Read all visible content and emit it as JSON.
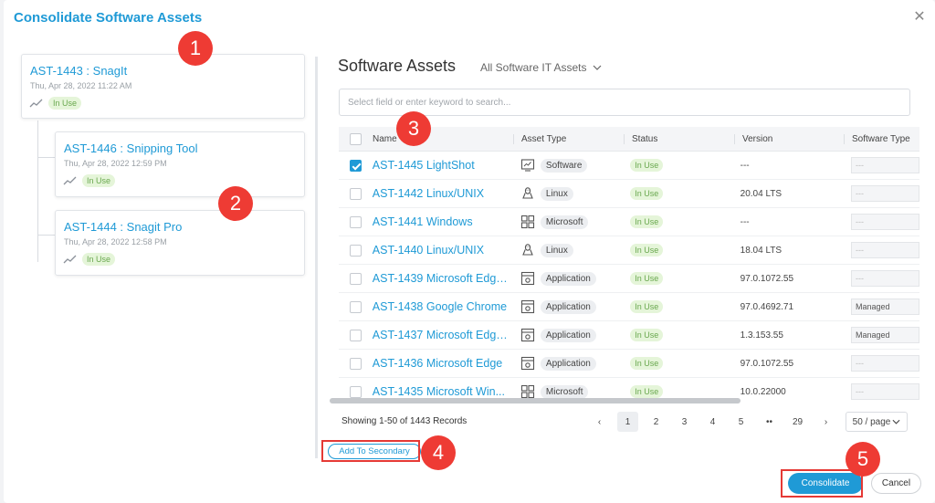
{
  "dialog": {
    "title": "Consolidate Software Assets"
  },
  "cards": [
    {
      "title": "AST-1443 : SnagIt",
      "date": "Thu, Apr 28, 2022 11:22 AM",
      "status": "In Use"
    },
    {
      "title": "AST-1446 : Snipping Tool",
      "date": "Thu, Apr 28, 2022 12:59 PM",
      "status": "In Use"
    },
    {
      "title": "AST-1444 : Snagit Pro",
      "date": "Thu, Apr 28, 2022 12:58 PM",
      "status": "In Use"
    }
  ],
  "assets": {
    "title": "Software Assets",
    "filter": "All Software IT Assets",
    "search_placeholder": "Select field or enter keyword to search...",
    "columns": {
      "name": "Name",
      "type": "Asset Type",
      "status": "Status",
      "version": "Version",
      "software_type": "Software Type"
    },
    "rows": [
      {
        "name": "AST-1445 LightShot",
        "type": "Software",
        "icon": "software-icon",
        "status": "In Use",
        "version": "---",
        "software_type": "---",
        "checked": true
      },
      {
        "name": "AST-1442 Linux/UNIX",
        "type": "Linux",
        "icon": "linux-icon",
        "status": "In Use",
        "version": "20.04 LTS",
        "software_type": "---",
        "checked": false
      },
      {
        "name": "AST-1441 Windows",
        "type": "Microsoft",
        "icon": "windows-icon",
        "status": "In Use",
        "version": "---",
        "software_type": "---",
        "checked": false
      },
      {
        "name": "AST-1440 Linux/UNIX",
        "type": "Linux",
        "icon": "linux-icon",
        "status": "In Use",
        "version": "18.04 LTS",
        "software_type": "---",
        "checked": false
      },
      {
        "name": "AST-1439 Microsoft Edge...",
        "type": "Application",
        "icon": "application-icon",
        "status": "In Use",
        "version": "97.0.1072.55",
        "software_type": "---",
        "checked": false
      },
      {
        "name": "AST-1438 Google Chrome",
        "type": "Application",
        "icon": "application-icon",
        "status": "In Use",
        "version": "97.0.4692.71",
        "software_type": "Managed",
        "checked": false
      },
      {
        "name": "AST-1437 Microsoft Edge...",
        "type": "Application",
        "icon": "application-icon",
        "status": "In Use",
        "version": "1.3.153.55",
        "software_type": "Managed",
        "checked": false
      },
      {
        "name": "AST-1436 Microsoft Edge",
        "type": "Application",
        "icon": "application-icon",
        "status": "In Use",
        "version": "97.0.1072.55",
        "software_type": "---",
        "checked": false
      },
      {
        "name": "AST-1435 Microsoft Win...",
        "type": "Microsoft",
        "icon": "windows-icon",
        "status": "In Use",
        "version": "10.0.22000",
        "software_type": "---",
        "checked": false
      }
    ],
    "records": "Showing 1-50 of 1443 Records",
    "pages": [
      "1",
      "2",
      "3",
      "4",
      "5",
      "••",
      "29"
    ],
    "active_page": "1",
    "per_page": "50 / page"
  },
  "buttons": {
    "add_secondary": "Add To Secondary",
    "consolidate": "Consolidate",
    "cancel": "Cancel"
  },
  "markers": [
    "1",
    "2",
    "3",
    "4",
    "5"
  ],
  "colors": {
    "accent": "#1f9ad6",
    "marker": "#ee3b34",
    "in_use_bg": "#e5f5d9",
    "in_use_text": "#6aa84f"
  }
}
